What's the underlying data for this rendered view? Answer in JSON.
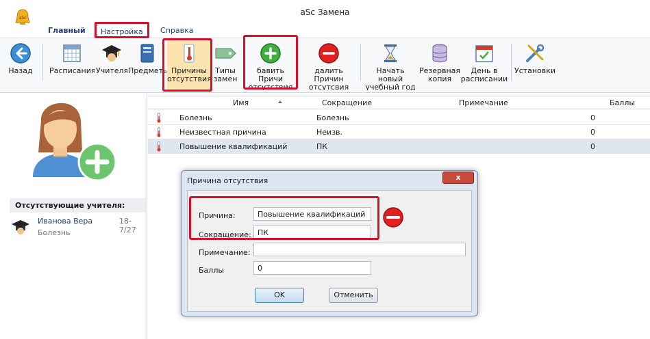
{
  "window": {
    "title": "aSc Замена"
  },
  "ribbon": {
    "tabs": [
      "Главный",
      "Настройка",
      "Справка"
    ]
  },
  "toolbar": {
    "back": "Назад",
    "timetables": "Расписания",
    "teachers": "Учителя",
    "subjects": "Предметы",
    "absence_reasons": [
      "Причины",
      "отсутствия"
    ],
    "sub_types": [
      "Типы",
      "замен"
    ],
    "add_reason": [
      "бавить Причи",
      "отсутствия"
    ],
    "delete_reason": [
      "далить Причин",
      "отсутсвия"
    ],
    "new_year": [
      "Начать новый",
      "учебный год"
    ],
    "backup": [
      "Резервная",
      "копия"
    ],
    "day_in_schedule": [
      "День в",
      "расписании"
    ],
    "settings": "Установки"
  },
  "left_pane": {
    "absent_header": "Отсутствующие учителя:",
    "absent_teachers": [
      {
        "name": "Иванова Вера",
        "date": "18-7/27",
        "reason": "Болезнь"
      }
    ]
  },
  "grid": {
    "columns": {
      "name": "Имя",
      "abbr": "Сокращение",
      "note": "Примечание",
      "score": "Баллы"
    },
    "rows": [
      {
        "name": "Болезнь",
        "abbr": "Болезнь",
        "note": "",
        "score": "0"
      },
      {
        "name": "Неизвестная причина",
        "abbr": "Неизв.",
        "note": "",
        "score": "0"
      },
      {
        "name": "Повышение квалификаций",
        "abbr": "ПК",
        "note": "",
        "score": "0"
      }
    ]
  },
  "dialog": {
    "title": "Причина отсутствия",
    "close_label": "x",
    "reason_label": "Причина:",
    "reason_value": "Повышение квалификаций",
    "abbr_label": "Сокращение:",
    "abbr_value": "ПК",
    "note_label": "Примечание:",
    "note_value": "",
    "score_label": "Баллы",
    "score_value": "0",
    "ok": "OK",
    "cancel": "Отменить"
  },
  "colors": {
    "highlight": "#d6102c",
    "tab_text": "#1e3e6e",
    "selected_row": "#dfe6ef",
    "dialog_frame": "#dce6f2"
  }
}
